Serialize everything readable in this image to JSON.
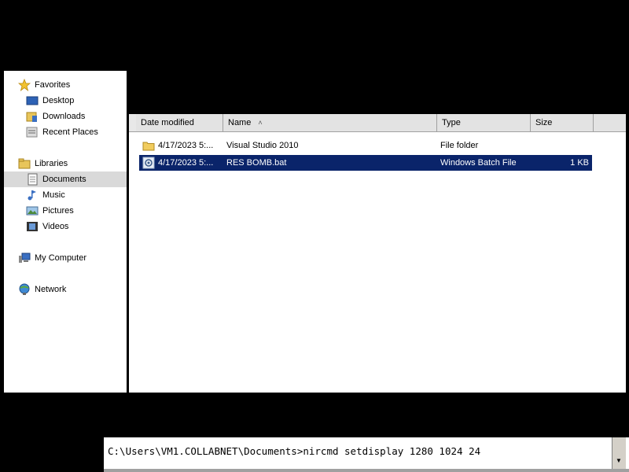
{
  "nav": {
    "favorites": "Favorites",
    "desktop": "Desktop",
    "downloads": "Downloads",
    "recent_places": "Recent Places",
    "libraries": "Libraries",
    "documents": "Documents",
    "music": "Music",
    "pictures": "Pictures",
    "videos": "Videos",
    "my_computer": "My Computer",
    "network": "Network"
  },
  "list": {
    "columns": {
      "date_modified": "Date modified",
      "name": "Name",
      "name_sort_glyph": "˄",
      "type": "Type",
      "size": "Size"
    },
    "rows": [
      {
        "date": "4/17/2023 5:...",
        "name": "Visual Studio 2010",
        "type": "File folder",
        "size": ""
      },
      {
        "date": "4/17/2023 5:...",
        "name": "RES BOMB.bat",
        "type": "Windows Batch File",
        "size": "1 KB"
      }
    ]
  },
  "console": {
    "command_line": "C:\\Users\\VM1.COLLABNET\\Documents>nircmd setdisplay 1280 1024 24"
  },
  "colors": {
    "selection": "#0a246a",
    "selection_text": "#ffffff",
    "desktop_background": "#000000"
  }
}
